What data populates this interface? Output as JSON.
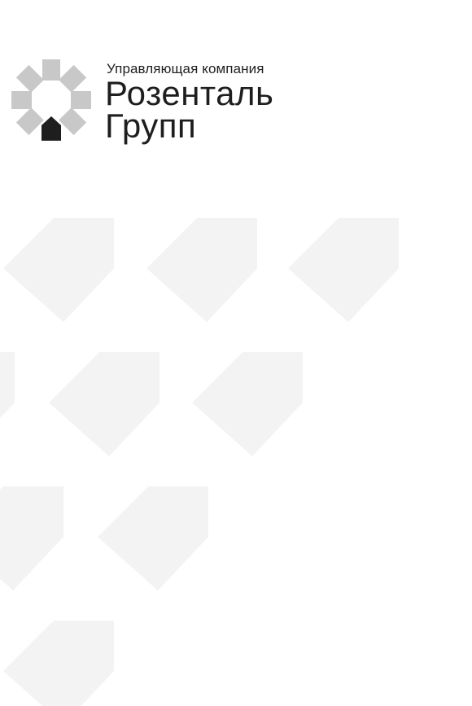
{
  "brand": {
    "subtitle": "Управляющая компания",
    "name_line1": "Розенталь",
    "name_line2": "Групп"
  },
  "colors": {
    "text": "#1e1e1e",
    "logo_gray": "#c8c8c8",
    "logo_dark": "#1e1e1e",
    "pattern": "#f3f3f3"
  }
}
